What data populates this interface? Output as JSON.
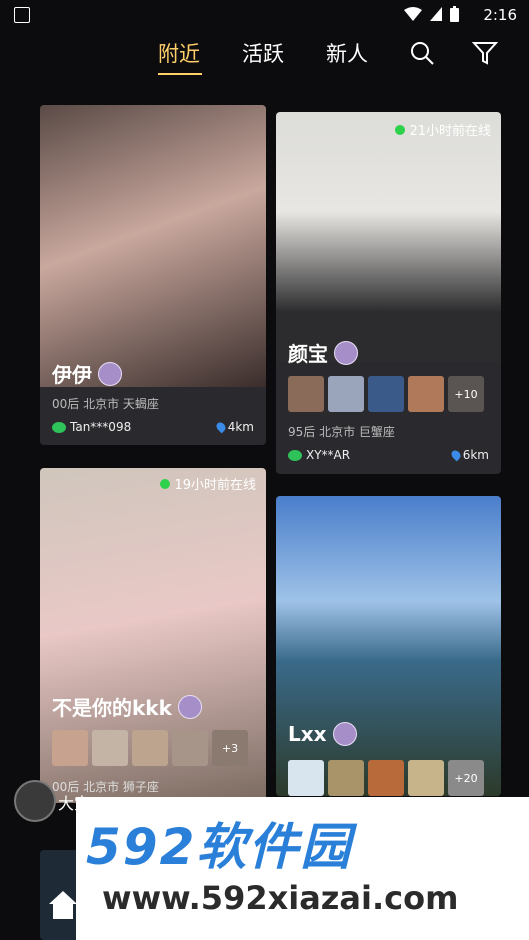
{
  "status": {
    "time": "2:16"
  },
  "nav": {
    "tabs": [
      "附近",
      "活跃",
      "新人"
    ],
    "active": "附近"
  },
  "cards": [
    {
      "name": "伊伊",
      "meta": "00后  北京市  天蝎座",
      "wechat": "Tan***098",
      "distance": "4km",
      "online": ""
    },
    {
      "name": "颜宝",
      "meta": "95后  北京市  巨蟹座",
      "wechat": "XY**AR",
      "distance": "6km",
      "online": "21小时前在线",
      "photo_count": "+10"
    },
    {
      "name": "不是你的kkk",
      "meta": "00后  北京市  狮子座",
      "online": "19小时前在线",
      "photo_count": "+3"
    },
    {
      "name": "Lxx",
      "online": "",
      "photo_count": "+20"
    }
  ],
  "floating": {
    "label": "大宝"
  },
  "watermark": {
    "brand": "592软件园",
    "url": "www.592xiazai.com"
  }
}
